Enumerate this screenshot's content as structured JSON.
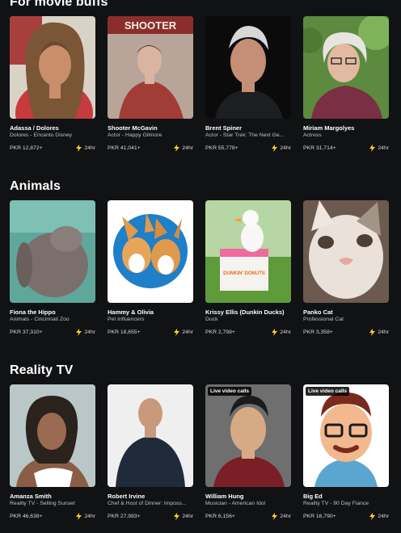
{
  "accent": "#ffd11a",
  "sections": [
    {
      "title": "For movie buffs",
      "cards": [
        {
          "name": "Adassa / Dolores",
          "subtitle": "Dolores - Encanto Disney",
          "price": "PKR 12,872+",
          "response": "24hr",
          "badge": ""
        },
        {
          "name": "Shooter McGavin",
          "subtitle": "Actor - Happy Gilmore",
          "price": "PKR 41,041+",
          "response": "24hr",
          "badge": "",
          "poster_text": "SHOOTER"
        },
        {
          "name": "Brent Spiner",
          "subtitle": "Actor - Star Trek: The Next Ge...",
          "price": "PKR 55,778+",
          "response": "24hr",
          "badge": ""
        },
        {
          "name": "Miriam Margolyes",
          "subtitle": "Actress",
          "price": "PKR 31,714+",
          "response": "24hr",
          "badge": ""
        }
      ]
    },
    {
      "title": "Animals",
      "cards": [
        {
          "name": "Fiona the Hippo",
          "subtitle": "Animals - Cincinnati Zoo",
          "price": "PKR 37,310+",
          "response": "24hr",
          "badge": ""
        },
        {
          "name": "Hammy & Olivia",
          "subtitle": "Pet Influencers",
          "price": "PKR 18,655+",
          "response": "24hr",
          "badge": ""
        },
        {
          "name": "Krissy Ellis (Dunkin Ducks)",
          "subtitle": "Duck",
          "price": "PKR 2,798+",
          "response": "24hr",
          "badge": "",
          "box_text": "DUNKIN' DONUTS"
        },
        {
          "name": "Panko Cat",
          "subtitle": "Professional Cat",
          "price": "PKR 3,358+",
          "response": "24hr",
          "badge": ""
        }
      ]
    },
    {
      "title": "Reality TV",
      "cards": [
        {
          "name": "Amanza Smith",
          "subtitle": "Reality TV - Selling Sunset",
          "price": "PKR 46,638+",
          "response": "24hr",
          "badge": ""
        },
        {
          "name": "Robert Irvine",
          "subtitle": "Chef & Host of Dinner: Imposs...",
          "price": "PKR 27,983+",
          "response": "24hr",
          "badge": ""
        },
        {
          "name": "William Hung",
          "subtitle": "Musician - American Idol",
          "price": "PKR 6,156+",
          "response": "24hr",
          "badge": "Live video calls"
        },
        {
          "name": "Big Ed",
          "subtitle": "Reality TV - 90 Day Fiance",
          "price": "PKR 16,790+",
          "response": "24hr",
          "badge": "Live video calls"
        }
      ]
    }
  ]
}
